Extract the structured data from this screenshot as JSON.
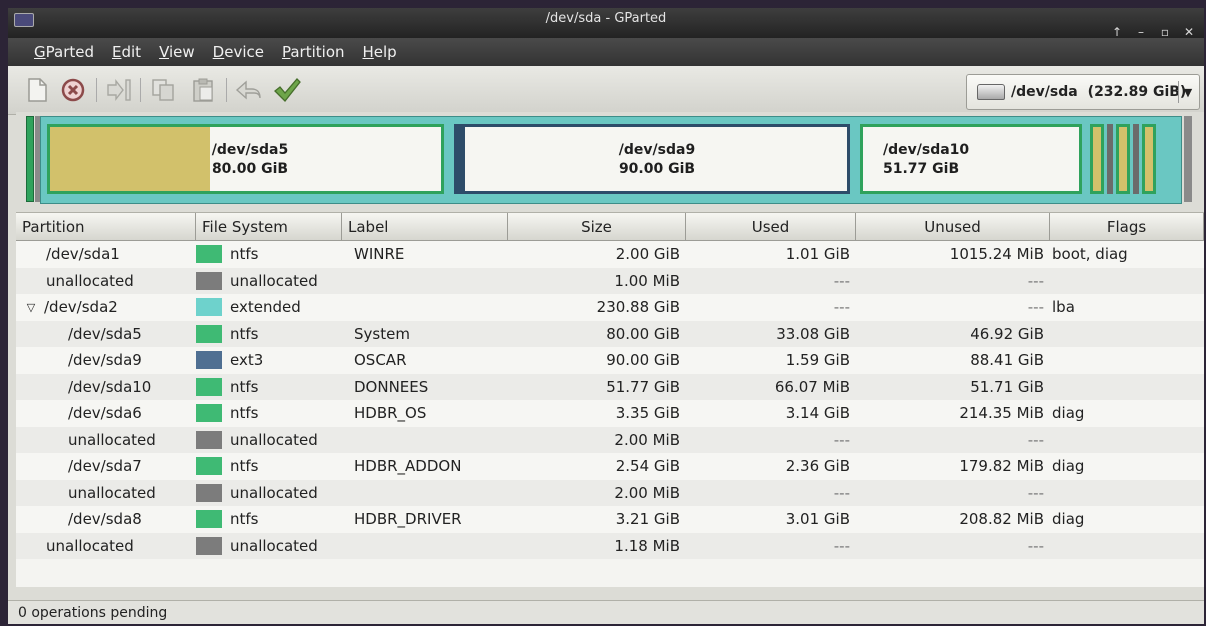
{
  "window": {
    "title": "/dev/sda - GParted"
  },
  "menu": [
    "GParted",
    "Edit",
    "View",
    "Device",
    "Partition",
    "Help"
  ],
  "toolbar": {
    "icons": [
      "new-icon",
      "delete-icon",
      "resize-move-icon",
      "copy-icon",
      "paste-icon",
      "undo-icon",
      "apply-icon"
    ],
    "device": "/dev/sda",
    "device_size": "(232.89 GiB)"
  },
  "diskmap": [
    {
      "name": "/dev/sda5",
      "size": "80.00 GiB",
      "fs_color": "#d2c16b",
      "used_fraction": 0.41
    },
    {
      "name": "/dev/sda9",
      "size": "90.00 GiB",
      "fs_color": "#2d4c69",
      "used_fraction": 0.02
    },
    {
      "name": "/dev/sda10",
      "size": "51.77 GiB",
      "fs_color": "#2fa25c",
      "used_fraction": 0.0
    }
  ],
  "columns": [
    "Partition",
    "File System",
    "Label",
    "Size",
    "Used",
    "Unused",
    "Flags"
  ],
  "rows": [
    {
      "partition": "/dev/sda1",
      "fs": "ntfs",
      "fs_color": "#3fba74",
      "label": "WINRE",
      "size": "2.00 GiB",
      "used": "1.01 GiB",
      "unused": "1015.24 MiB",
      "flags": "boot, diag",
      "indent": 1
    },
    {
      "partition": "unallocated",
      "fs": "unallocated",
      "fs_color": "#7c7c7c",
      "label": "",
      "size": "1.00 MiB",
      "used": "---",
      "unused": "---",
      "flags": "",
      "indent": 1
    },
    {
      "partition": "/dev/sda2",
      "fs": "extended",
      "fs_color": "#6ed2cc",
      "label": "",
      "size": "230.88 GiB",
      "used": "---",
      "unused": "---",
      "flags": "lba",
      "indent": 0,
      "expander": "▽"
    },
    {
      "partition": "/dev/sda5",
      "fs": "ntfs",
      "fs_color": "#3fba74",
      "label": "System",
      "size": "80.00 GiB",
      "used": "33.08 GiB",
      "unused": "46.92 GiB",
      "flags": "",
      "indent": 2
    },
    {
      "partition": "/dev/sda9",
      "fs": "ext3",
      "fs_color": "#4f6f92",
      "label": "OSCAR",
      "size": "90.00 GiB",
      "used": "1.59 GiB",
      "unused": "88.41 GiB",
      "flags": "",
      "indent": 2
    },
    {
      "partition": "/dev/sda10",
      "fs": "ntfs",
      "fs_color": "#3fba74",
      "label": "DONNEES",
      "size": "51.77 GiB",
      "used": "66.07 MiB",
      "unused": "51.71 GiB",
      "flags": "",
      "indent": 2
    },
    {
      "partition": "/dev/sda6",
      "fs": "ntfs",
      "fs_color": "#3fba74",
      "label": "HDBR_OS",
      "size": "3.35 GiB",
      "used": "3.14 GiB",
      "unused": "214.35 MiB",
      "flags": "diag",
      "indent": 2
    },
    {
      "partition": "unallocated",
      "fs": "unallocated",
      "fs_color": "#7c7c7c",
      "label": "",
      "size": "2.00 MiB",
      "used": "---",
      "unused": "---",
      "flags": "",
      "indent": 2
    },
    {
      "partition": "/dev/sda7",
      "fs": "ntfs",
      "fs_color": "#3fba74",
      "label": "HDBR_ADDON",
      "size": "2.54 GiB",
      "used": "2.36 GiB",
      "unused": "179.82 MiB",
      "flags": "diag",
      "indent": 2
    },
    {
      "partition": "unallocated",
      "fs": "unallocated",
      "fs_color": "#7c7c7c",
      "label": "",
      "size": "2.00 MiB",
      "used": "---",
      "unused": "---",
      "flags": "",
      "indent": 2
    },
    {
      "partition": "/dev/sda8",
      "fs": "ntfs",
      "fs_color": "#3fba74",
      "label": "HDBR_DRIVER",
      "size": "3.21 GiB",
      "used": "3.01 GiB",
      "unused": "208.82 MiB",
      "flags": "diag",
      "indent": 2
    },
    {
      "partition": "unallocated",
      "fs": "unallocated",
      "fs_color": "#7c7c7c",
      "label": "",
      "size": "1.18 MiB",
      "used": "---",
      "unused": "---",
      "flags": "",
      "indent": 1
    }
  ],
  "status": "0 operations pending"
}
